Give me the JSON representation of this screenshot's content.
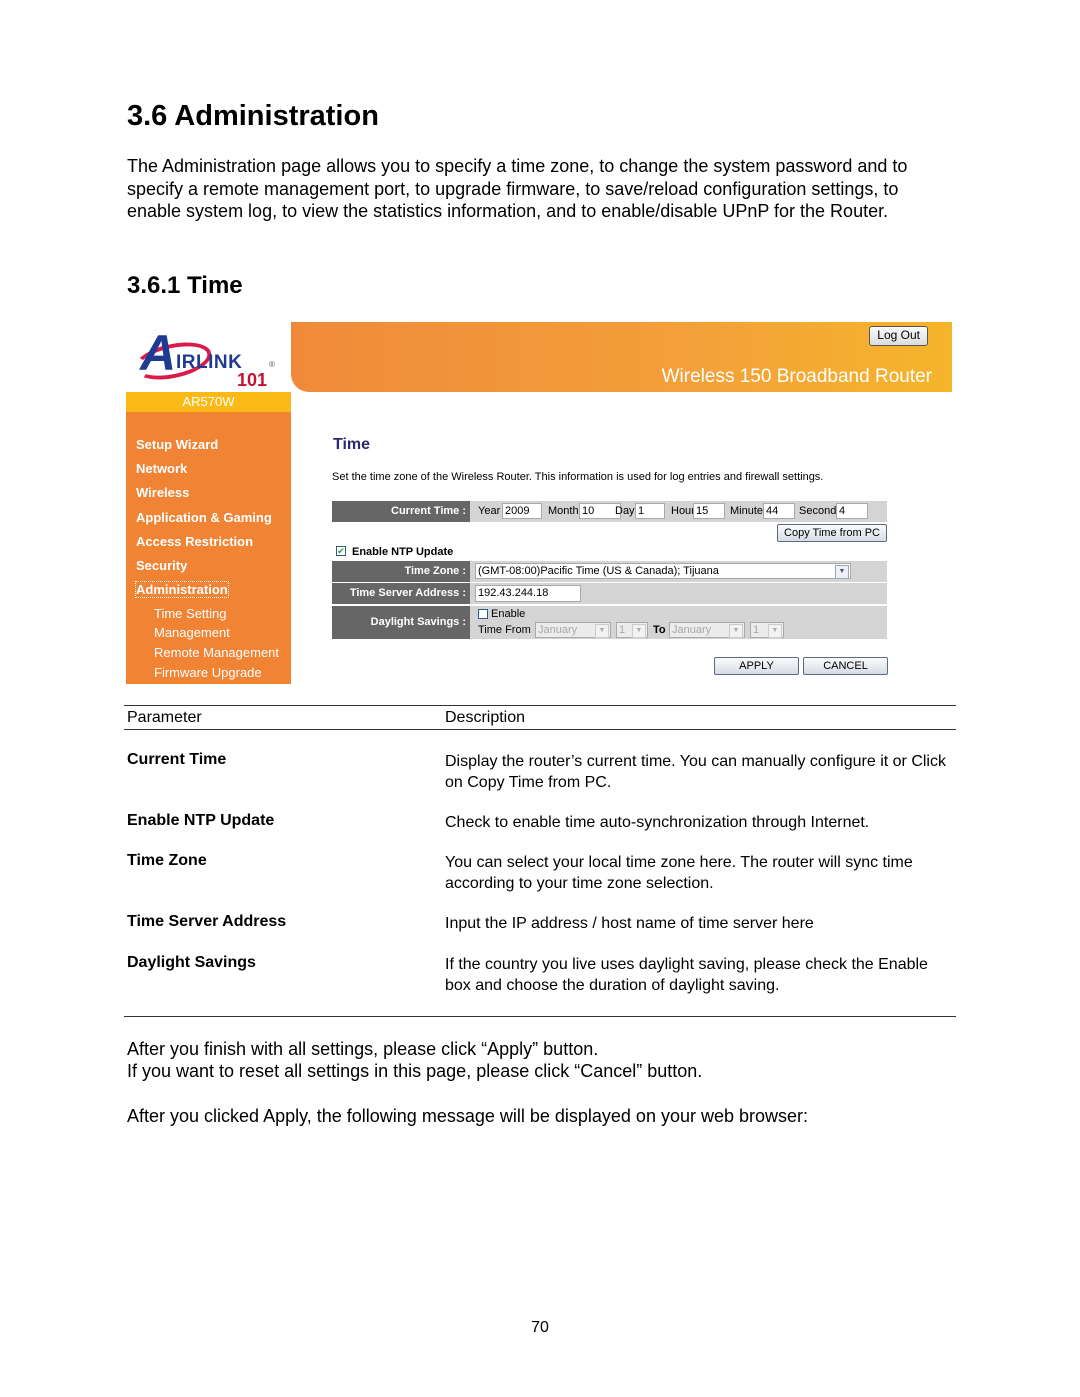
{
  "document": {
    "section_title": "3.6 Administration",
    "intro": "The Administration page allows you to specify a time zone, to change the system password and to specify a remote management port, to upgrade firmware, to save/reload configuration settings, to enable system log, to view the statistics information, and to enable/disable UPnP for the Router.",
    "subsection_title": "3.6.1 Time",
    "page_number": "70"
  },
  "router_ui": {
    "brand": {
      "logo_text": "AIRLINK",
      "logo_number": "101",
      "model": "AR570W"
    },
    "header": {
      "logout_label": "Log Out",
      "product_title": "Wireless 150 Broadband Router"
    },
    "sidebar": {
      "items": [
        {
          "label": "Setup Wizard"
        },
        {
          "label": "Network"
        },
        {
          "label": "Wireless"
        },
        {
          "label": "Application & Gaming"
        },
        {
          "label": "Access Restriction"
        },
        {
          "label": "Security"
        },
        {
          "label": "Administration",
          "active": true
        }
      ],
      "subitems": [
        {
          "label": "Time Setting"
        },
        {
          "label": "Management"
        },
        {
          "label": "Remote Management"
        },
        {
          "label": "Firmware Upgrade"
        }
      ]
    },
    "content": {
      "title": "Time",
      "description": "Set the time zone of the Wireless Router. This information is used for log entries and firewall settings.",
      "current_time": {
        "label": "Current Time :",
        "year_label": "Year",
        "year": "2009",
        "month_label": "Month",
        "month": "10",
        "day_label": "Day",
        "day": "1",
        "hour_label": "Hour",
        "hour": "15",
        "minute_label": "Minute",
        "minute": "44",
        "second_label": "Second",
        "second": "4"
      },
      "copy_time_label": "Copy Time from PC",
      "ntp": {
        "label": "Enable NTP Update",
        "checked": true
      },
      "time_zone": {
        "label": "Time Zone :",
        "value": "(GMT-08:00)Pacific Time (US & Canada); Tijuana"
      },
      "time_server": {
        "label": "Time Server Address :",
        "value": "192.43.244.18"
      },
      "daylight": {
        "label": "Daylight Savings :",
        "enable_label": "Enable",
        "enabled": false,
        "time_from_label": "Time From",
        "from_month": "January",
        "from_day": "1",
        "to_label": "To",
        "to_month": "January",
        "to_day": "1"
      },
      "apply_label": "APPLY",
      "cancel_label": "CANCEL"
    },
    "icons": {
      "checkbox_checked": "✔",
      "dropdown_arrow": "▼"
    }
  },
  "param_table": {
    "headers": {
      "parameter": "Parameter",
      "description": "Description"
    },
    "rows": [
      {
        "name": "Current Time",
        "description": "Display the router’s current time. You can manually configure it or Click on Copy Time from PC."
      },
      {
        "name": "Enable NTP Update",
        "description": "Check to enable time auto-synchronization through Internet."
      },
      {
        "name": "Time Zone",
        "description": "You can select your local time zone here. The router will sync time according to your time zone selection."
      },
      {
        "name": "Time Server Address",
        "description": "Input the IP address / host name of time server here"
      },
      {
        "name": "Daylight Savings",
        "description": "If the country you live uses daylight saving, please check the Enable box and choose the duration of daylight saving."
      }
    ]
  },
  "after_text": {
    "line1": "After you finish with all settings, please click “Apply” button.",
    "line2": "If you want to reset all settings in this page, please click “Cancel” button.",
    "line3": "After you clicked Apply, the following message will be displayed on your web browser:"
  }
}
